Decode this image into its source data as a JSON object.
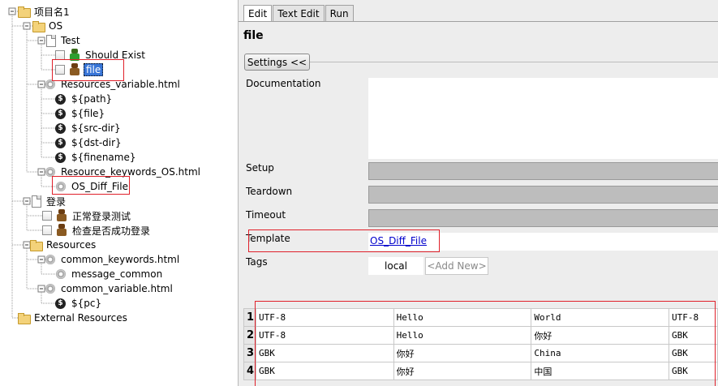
{
  "tree": {
    "project": "项目名1",
    "os_dir": "OS",
    "test_file": "Test",
    "tc_should_exist": "Should Exist",
    "tc_file": "file",
    "res_var_file": "Resources_variable.html",
    "var_path": "${path}",
    "var_file": "${file}",
    "var_src": "${src-dir}",
    "var_dst": "${dst-dir}",
    "var_finename": "${finename}",
    "res_kw_file": "Resource_keywords_OS.html",
    "kw_os_diff": "OS_Diff_File",
    "login_file": "登录",
    "tc_login_ok": "正常登录测试",
    "tc_login_check": "检查是否成功登录",
    "resources_dir": "Resources",
    "common_kw_file": "common_keywords.html",
    "kw_message": "message_common",
    "common_var_file": "common_variable.html",
    "var_pc": "${pc}",
    "external": "External Resources"
  },
  "editor": {
    "tabs": [
      "Edit",
      "Text Edit",
      "Run"
    ],
    "title": "file",
    "settings_button": "Settings <<",
    "labels": {
      "documentation": "Documentation",
      "setup": "Setup",
      "teardown": "Teardown",
      "timeout": "Timeout",
      "template": "Template",
      "tags": "Tags"
    },
    "template_value": "OS_Diff_File",
    "tag_local": "local",
    "tag_add_new": "<Add New>"
  },
  "grid": {
    "rows": [
      {
        "n": "1",
        "c1": "UTF-8",
        "c2": "Hello",
        "c3": "World",
        "c4": "UTF-8"
      },
      {
        "n": "2",
        "c1": "UTF-8",
        "c2": "Hello",
        "c3": "你好",
        "c4": "GBK"
      },
      {
        "n": "3",
        "c1": "GBK",
        "c2": "你好",
        "c3": "China",
        "c4": "GBK"
      },
      {
        "n": "4",
        "c1": "GBK",
        "c2": "你好",
        "c3": "中国",
        "c4": "GBK"
      }
    ]
  },
  "colors": {
    "highlight_box": "#e0202a",
    "selection": "#3875d7",
    "link": "#0000cc"
  }
}
